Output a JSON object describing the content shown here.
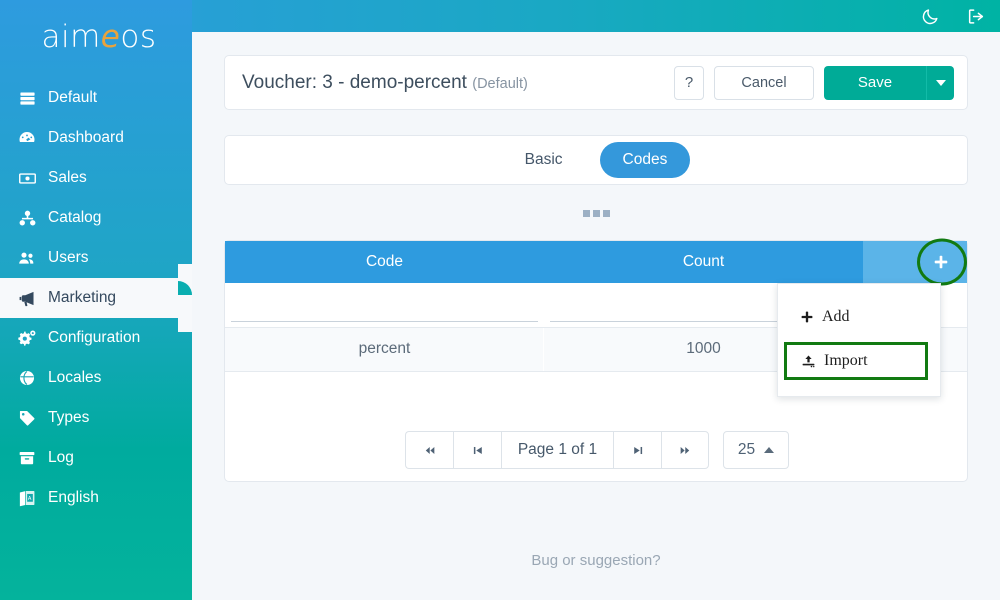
{
  "topbar": {
    "icons": [
      {
        "name": "dark-mode-moon-icon",
        "label": "Dark mode"
      },
      {
        "name": "logout-icon",
        "label": "Logout"
      }
    ]
  },
  "sidebar": {
    "logo": {
      "before": "aim",
      "accent": "e",
      "after": "os"
    },
    "items": [
      {
        "label": "Default",
        "icon": "server-icon",
        "active": false
      },
      {
        "label": "Dashboard",
        "icon": "dashboard-icon",
        "active": false
      },
      {
        "label": "Sales",
        "icon": "money-bill-icon",
        "active": false
      },
      {
        "label": "Catalog",
        "icon": "sitemap-icon",
        "active": false
      },
      {
        "label": "Users",
        "icon": "users-icon",
        "active": false
      },
      {
        "label": "Marketing",
        "icon": "bullhorn-icon",
        "active": true
      },
      {
        "label": "Configuration",
        "icon": "cogs-icon",
        "active": false
      },
      {
        "label": "Locales",
        "icon": "globe-icon",
        "active": false
      },
      {
        "label": "Types",
        "icon": "tag-icon",
        "active": false
      },
      {
        "label": "Log",
        "icon": "archive-icon",
        "active": false
      },
      {
        "label": "English",
        "icon": "language-flag-icon",
        "active": false
      }
    ]
  },
  "header": {
    "title": "Voucher: 3 - demo-percent",
    "title_suffix": "(Default)",
    "help_label": "?",
    "cancel_label": "Cancel",
    "save_label": "Save",
    "save_dropdown_label": "Save options"
  },
  "tabs": [
    {
      "label": "Basic",
      "active": false
    },
    {
      "label": "Codes",
      "active": true
    }
  ],
  "table": {
    "columns": [
      {
        "label": "Code"
      },
      {
        "label": "Count"
      },
      {
        "label": ""
      }
    ],
    "filter_row": {
      "code": "",
      "count": ""
    },
    "rows": [
      {
        "code": "percent",
        "count": "1000"
      }
    ],
    "add_button_label": "+"
  },
  "dropdown": {
    "items": [
      {
        "label": "Add",
        "icon": "plus-icon",
        "highlighted": false
      },
      {
        "label": "Import",
        "icon": "upload-icon",
        "highlighted": true
      }
    ]
  },
  "pagination": {
    "first_label": "First page",
    "prev_label": "Previous page",
    "page_label": "Page 1 of 1",
    "next_label": "Next page",
    "last_label": "Last page",
    "page_size": "25"
  },
  "footer": {
    "text": "Bug or suggestion?"
  },
  "colors": {
    "brand_blue": "#2e9bdf",
    "brand_teal": "#00ab97",
    "table_header": "#2e9bdf",
    "table_header_action": "#5bb4e8",
    "tab_active": "#3498db",
    "highlight_green": "#127a12",
    "logo_accent": "#e8a33d",
    "page_bg": "#f4f7fa"
  }
}
